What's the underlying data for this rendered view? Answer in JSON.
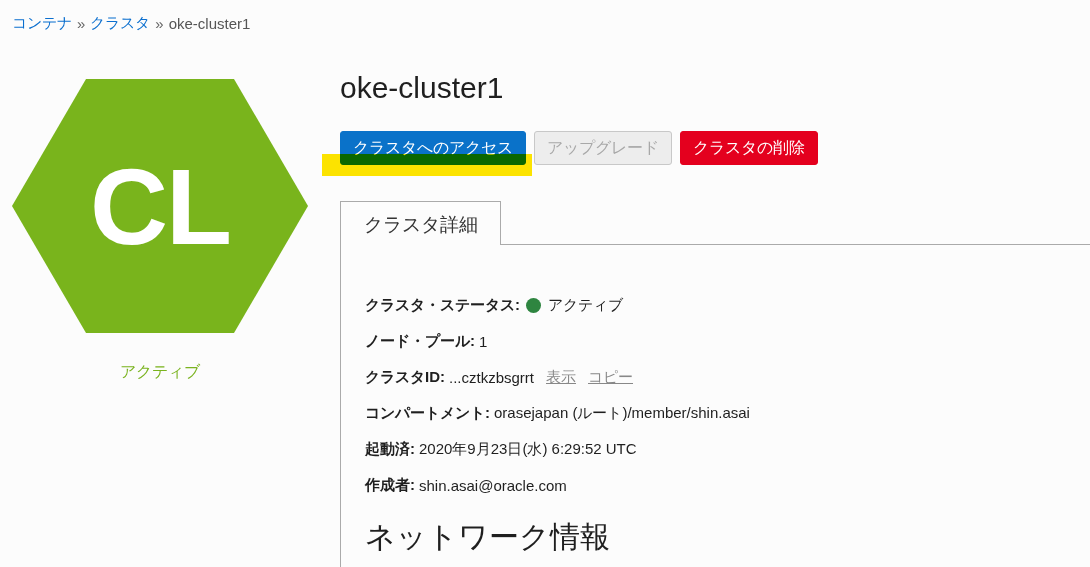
{
  "breadcrumb": [
    {
      "label": "コンテナ",
      "link": true
    },
    {
      "separator": "»",
      "label": "クラスタ",
      "link": true
    },
    {
      "separator": "»",
      "label": "oke-cluster1",
      "link": false
    }
  ],
  "badge": {
    "initials": "CL",
    "status": "アクティブ"
  },
  "title": "oke-cluster1",
  "buttons": [
    {
      "label": "クラスタへのアクセス",
      "kind": "primary",
      "disabled": false,
      "highlighted": true
    },
    {
      "label": "アップグレード",
      "kind": "default",
      "disabled": true,
      "highlighted": false
    },
    {
      "label": "クラスタの削除",
      "kind": "danger",
      "disabled": false,
      "highlighted": false
    }
  ],
  "tabs": [
    {
      "label": "クラスタ詳細",
      "selected": true
    }
  ],
  "details": [
    {
      "kind": "status",
      "label": "クラスタ・ステータス:",
      "value": "アクティブ"
    },
    {
      "kind": "text",
      "label": "ノード・プール:",
      "value": "1"
    },
    {
      "kind": "id",
      "label": "クラスタID:",
      "value": "...cztkzbsgrrt",
      "links": [
        "表示",
        "コピー"
      ]
    },
    {
      "kind": "text",
      "label": "コンパートメント:",
      "value": "orasejapan (ルート)/member/shin.asai"
    },
    {
      "kind": "text",
      "label": "起動済:",
      "value": "2020年9月23日(水) 6:29:52 UTC"
    },
    {
      "kind": "text",
      "label": "作成者:",
      "value": "shin.asai@oracle.com"
    }
  ],
  "section_heading": "ネットワーク情報"
}
